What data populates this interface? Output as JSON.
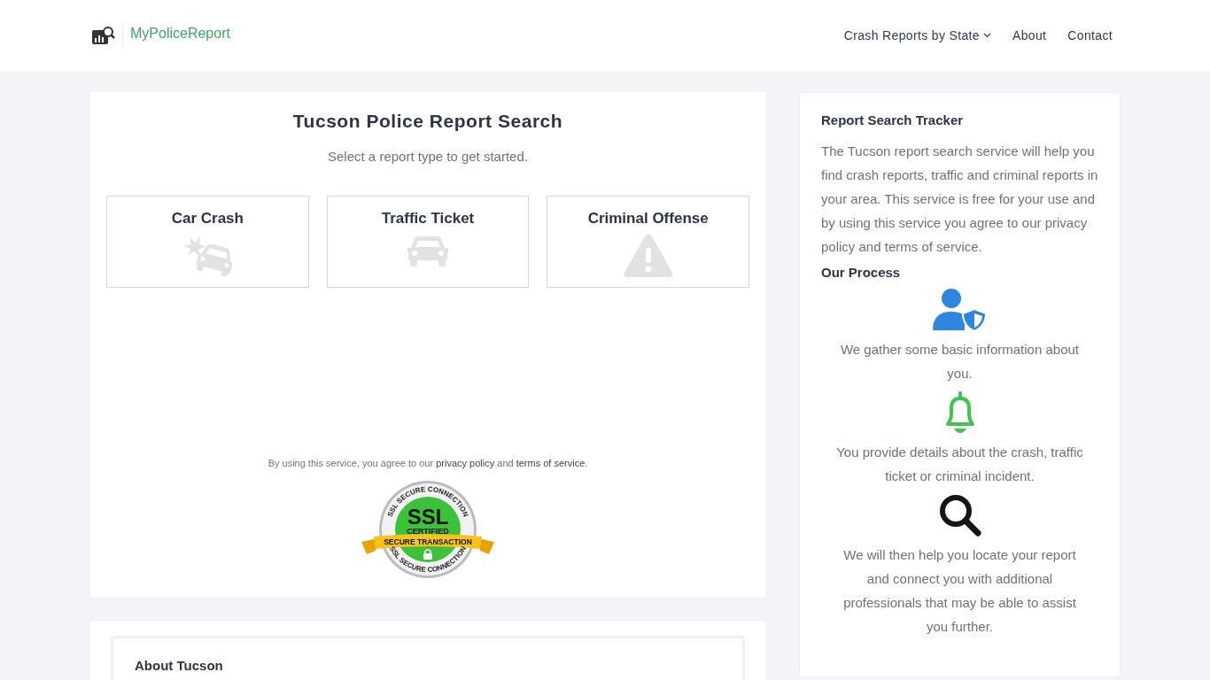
{
  "header": {
    "logo": {
      "part1": "MyPolice",
      "part2": "Report"
    },
    "nav": [
      {
        "label": "Crash Reports by State",
        "dropdown": true
      },
      {
        "label": "About",
        "dropdown": false
      },
      {
        "label": "Contact",
        "dropdown": false
      }
    ]
  },
  "search": {
    "title": "Tucson Police Report Search",
    "subtitle": "Select a report type to get started.",
    "types": [
      {
        "label": "Car Crash",
        "kind": "crash"
      },
      {
        "label": "Traffic Ticket",
        "kind": "car"
      },
      {
        "label": "Criminal Offense",
        "kind": "warning"
      }
    ],
    "agreement": {
      "before": "By using this service, you agree to our ",
      "privacy": "privacy policy",
      "middle": " and ",
      "terms": "terms of service",
      "after": "."
    },
    "badge": {
      "ring_top": "SSL SECURE CONNECTION",
      "ring_bottom": "SSL SECURE CONNECTION",
      "title": "SSL",
      "subtitle": "CERTIFIED",
      "ribbon": "SECURE TRANSACTION"
    }
  },
  "about": {
    "title": "About Tucson"
  },
  "sidebar": {
    "title": "Report Search Tracker",
    "intro": "The Tucson report search service will help you find crash reports, traffic and criminal reports in your area. This service is free for your use and by using this service you agree to our privacy policy and terms of service.",
    "process_title": "Our Process",
    "steps": [
      {
        "kind": "user",
        "text": "We gather some basic information about you."
      },
      {
        "kind": "bell",
        "text": "You provide details about the crash, traffic ticket or criminal incident."
      },
      {
        "kind": "search",
        "text": "We will then help you locate your report and connect you with additional professionals that may be able to assist you further."
      }
    ]
  }
}
